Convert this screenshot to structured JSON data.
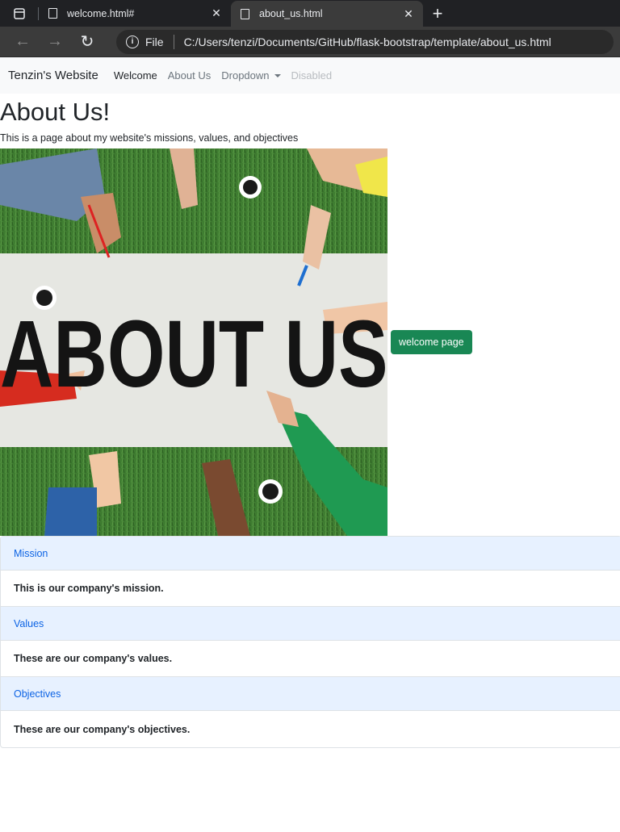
{
  "browser": {
    "tabs": [
      {
        "title": "welcome.html#",
        "active": false
      },
      {
        "title": "about_us.html",
        "active": true
      }
    ],
    "address": {
      "scheme": "File",
      "url": "C:/Users/tenzi/Documents/GitHub/flask-bootstrap/template/about_us.html"
    }
  },
  "navbar": {
    "brand": "Tenzin's Website",
    "links": [
      "Welcome",
      "About Us",
      "Dropdown",
      "Disabled"
    ]
  },
  "page": {
    "title": "About Us!",
    "subtitle": "This is a page about my website's missions, values, and objectives",
    "hero_text": "ABOUT US",
    "welcome_button": "welcome page"
  },
  "accordion": [
    {
      "header": "Mission",
      "body": "This is our company's mission."
    },
    {
      "header": "Values",
      "body": "These are our company's values."
    },
    {
      "header": "Objectives",
      "body": "These are our company's objectives."
    }
  ],
  "colors": {
    "button_green": "#198754",
    "accordion_header_bg": "#e7f1ff",
    "accordion_header_text": "#0c63e4"
  }
}
